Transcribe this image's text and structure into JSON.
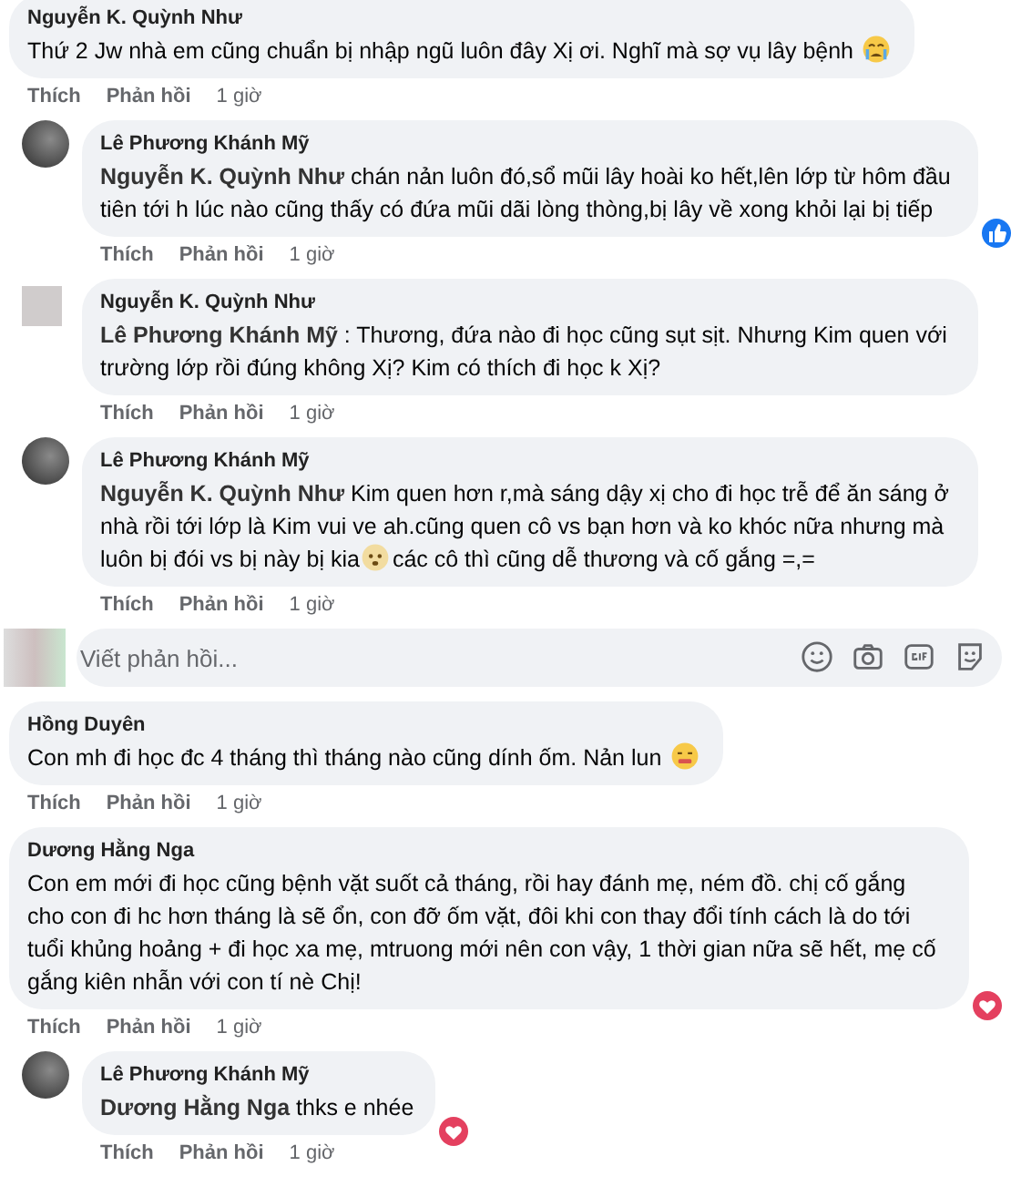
{
  "comments": [
    {
      "author": "Nguyễn K. Quỳnh Như",
      "parts": [
        {
          "kind": "text",
          "text": "Thứ 2 Jw nhà em cũng chuẩn bị nhập ngũ luôn đây Xị ơi. Nghĩ mà sợ vụ lây bệnh "
        },
        {
          "kind": "crying_emoji"
        }
      ],
      "actions": [
        "Thích",
        "Phản hồi",
        "1 giờ"
      ],
      "replies": [
        {
          "author": "Lê Phương Khánh Mỹ",
          "avatar": {
            "kind": "photo"
          },
          "parts": [
            {
              "kind": "mention",
              "text": "Nguyễn K. Quỳnh Như"
            },
            {
              "kind": "text",
              "text": " chán nản luôn đó,sổ mũi lây hoài ko hết,lên lớp từ hôm đầu tiên tới h lúc nào cũng thấy có đứa mũi dãi lòng thòng,bị lây về xong khỏi lại bị tiếp"
            }
          ],
          "reaction": {
            "kind": "like"
          },
          "actions": [
            "Thích",
            "Phản hồi",
            "1 giờ"
          ]
        },
        {
          "author": "Nguyễn K. Quỳnh Như",
          "avatar": {
            "kind": "blurred"
          },
          "parts": [
            {
              "kind": "mention",
              "text": "Lê Phương Khánh Mỹ"
            },
            {
              "kind": "text",
              "text": " : Thương, đứa nào đi học cũng sụt sịt. Nhưng Kim quen với trường lớp rồi đúng không Xị? Kim có thích đi học k Xị?"
            }
          ],
          "actions": [
            "Thích",
            "Phản hồi",
            "1 giờ"
          ]
        },
        {
          "author": "Lê Phương Khánh Mỹ",
          "avatar": {
            "kind": "photo"
          },
          "parts": [
            {
              "kind": "mention",
              "text": "Nguyễn K. Quỳnh Như"
            },
            {
              "kind": "text",
              "text": " Kim quen hơn r,mà sáng dậy xị cho đi học trễ để ăn sáng ở nhà rồi tới lớp là Kim vui ve ah.cũng quen cô vs bạn hơn và ko khóc nữa nhưng mà luôn bị đói vs bị này bị kia"
            },
            {
              "kind": "worried_emoji"
            },
            {
              "kind": "text",
              "text": "các cô thì cũng dễ thương và cố gắng =,="
            }
          ],
          "actions": [
            "Thích",
            "Phản hồi",
            "1 giờ"
          ]
        }
      ],
      "reply_field": {
        "placeholder": "Viết phản hồi..."
      }
    },
    {
      "author": "Hồng Duyên",
      "parts": [
        {
          "kind": "text",
          "text": "Con mh đi học đc 4 tháng thì tháng nào cũng dính ốm. Nản lun "
        },
        {
          "kind": "grimacing_emoji"
        }
      ],
      "actions": [
        "Thích",
        "Phản hồi",
        "1 giờ"
      ]
    },
    {
      "author": "Dương Hằng Nga",
      "parts": [
        {
          "kind": "text",
          "text": "Con em mới đi học cũng bệnh vặt suốt cả tháng, rồi hay đánh mẹ, ném đồ. chị cố gắng cho con đi hc hơn tháng là sẽ ổn, con đỡ ốm vặt, đôi khi con thay đổi tính cách là do tới tuổi khủng hoảng + đi học xa mẹ, mtruong mới nên con vậy, 1 thời gian nữa sẽ hết, mẹ cố gắng kiên nhẫn với con tí nè Chị!"
        }
      ],
      "reaction": {
        "kind": "love"
      },
      "actions": [
        "Thích",
        "Phản hồi",
        "1 giờ"
      ],
      "replies": [
        {
          "author": "Lê Phương Khánh Mỹ",
          "avatar": {
            "kind": "photo"
          },
          "parts": [
            {
              "kind": "mention",
              "text": "Dương Hằng Nga"
            },
            {
              "kind": "text",
              "text": " thks e nhée"
            }
          ],
          "reaction": {
            "kind": "love"
          },
          "actions": [
            "Thích",
            "Phản hồi",
            "1 giờ"
          ]
        }
      ]
    }
  ]
}
